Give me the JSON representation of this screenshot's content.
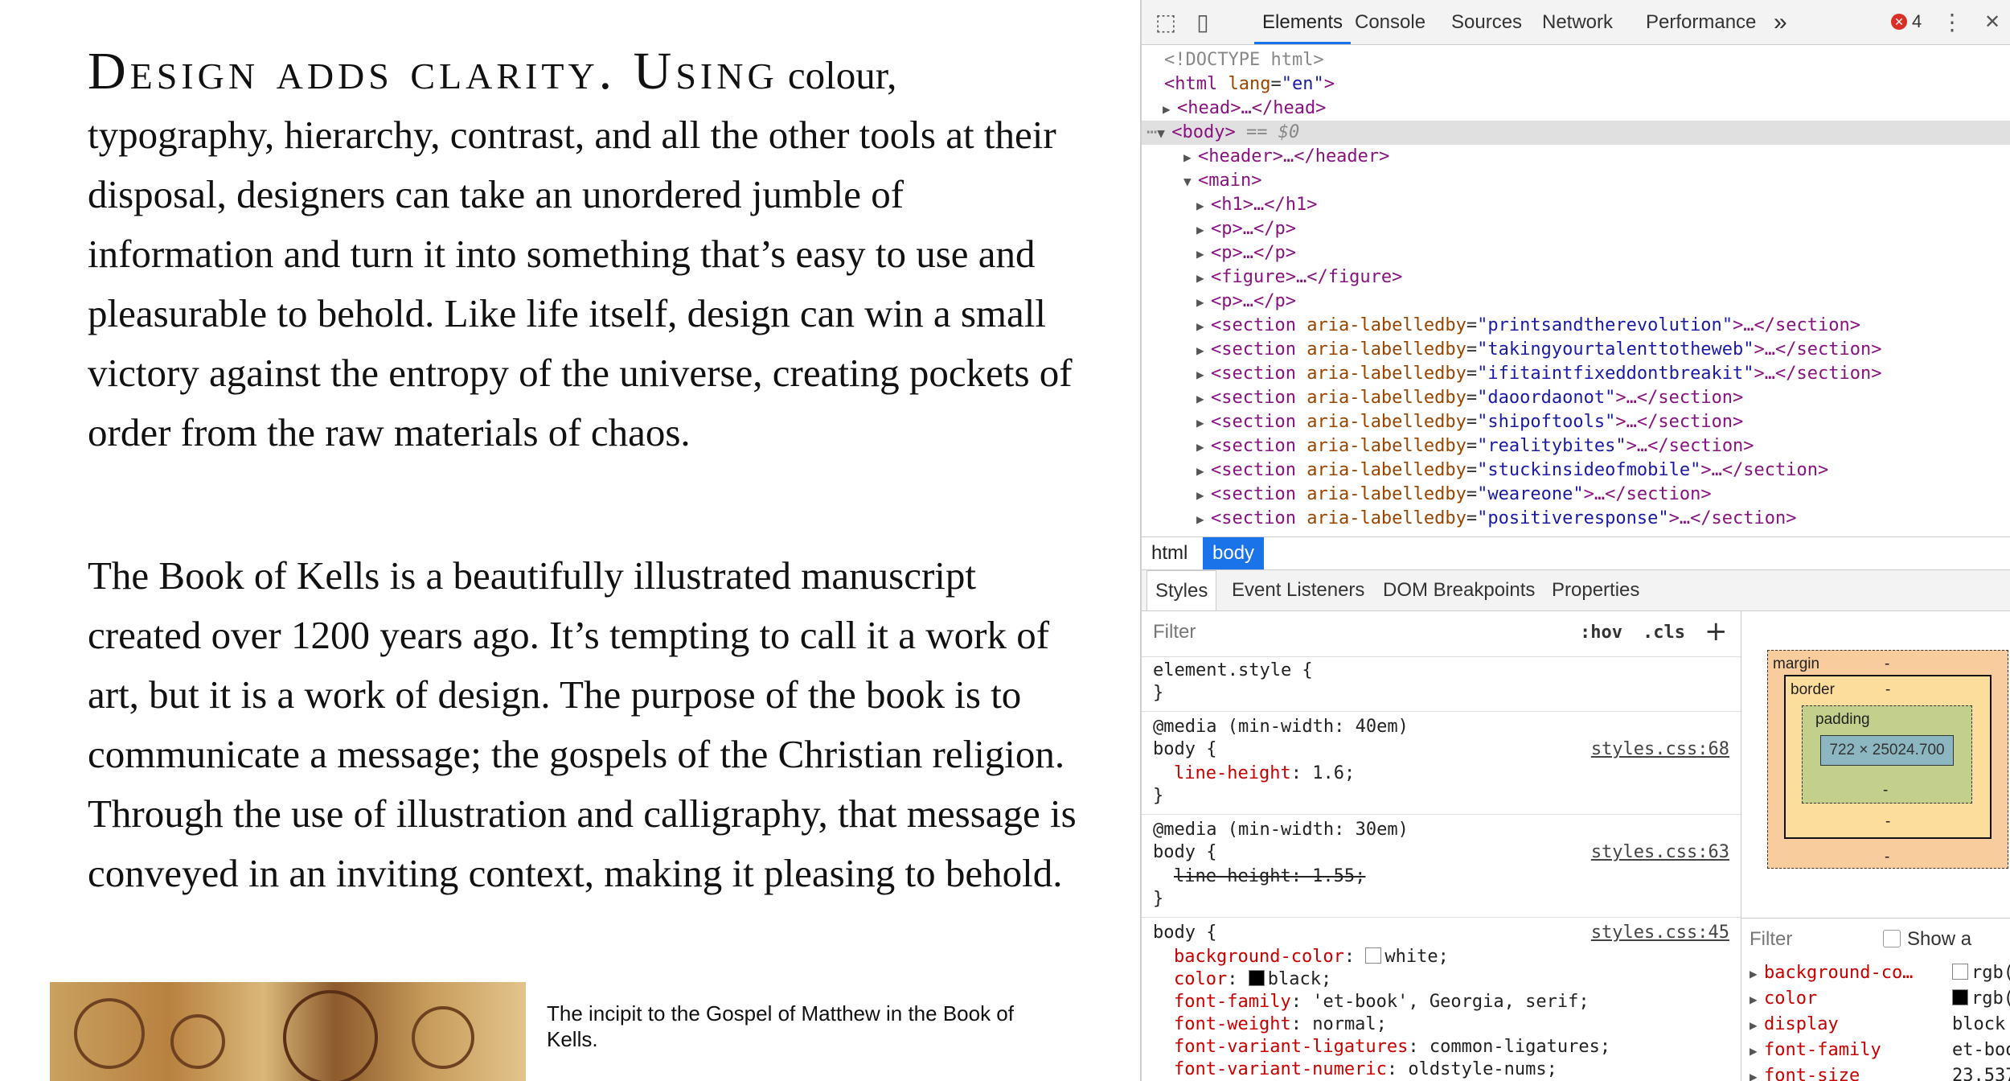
{
  "page": {
    "p1_lead": "Design adds clarity. Using",
    "p1_body": "colour, typography, hierarchy, contrast, and all the other tools at their disposal, designers can take an unordered jumble of information and turn it into something that’s easy to use and pleasurable to behold. Like life itself, design can win a small victory against the entropy of the universe, creating pockets of order from the raw materials of chaos.",
    "p2": "The Book of Kells is a beautifully illustrated manuscript created over 1200 years ago. It’s tempting to call it a work of art, but it is a work of design. The purpose of the book is to communicate a message; the gospels of the Christian religion. Through the use of illustration and calligraphy, that message is conveyed in an inviting context, making it pleasing to behold.",
    "figcaption": "The incipit to the Gospel of Matthew in the Book of Kells."
  },
  "devtools": {
    "tabs": [
      "Elements",
      "Console",
      "Sources",
      "Network",
      "Performance"
    ],
    "more": "»",
    "error_count": "4",
    "menu": "⋮",
    "close": "✕",
    "dom": {
      "doctype": "<!DOCTYPE html>",
      "html_open": "<html",
      "html_lang_attr": "lang",
      "html_lang_val": "\"en\"",
      "head": "<head>…</head>",
      "body": "<body>",
      "body_ref": "== $0",
      "header": "<header>…</header>",
      "main": "<main>",
      "children": [
        "<h1>…</h1>",
        "<p>…</p>",
        "<p>…</p>",
        "<figure>…</figure>",
        "<p>…</p>"
      ],
      "sections": [
        "printsandtherevolution",
        "takingyourtalenttotheweb",
        "ifitaintfixeddontbreakit",
        "daoordaonot",
        "shipoftools",
        "realitybites",
        "stuckinsideofmobile",
        "weareone",
        "positiveresponse"
      ],
      "section_tag": "<section",
      "section_attr": "aria-labelledby",
      "section_close": ">…</section>"
    },
    "breadcrumb": [
      "html",
      "body"
    ],
    "subtabs": [
      "Styles",
      "Event Listeners",
      "DOM Breakpoints",
      "Properties"
    ],
    "styles": {
      "filter_placeholder": "Filter",
      "hov": ":hov",
      "cls": ".cls",
      "plus": "+",
      "element_style": "element.style {",
      "close_brace": "}",
      "rule1": {
        "media": "@media (min-width: 40em)",
        "selector": "body {",
        "link": "styles.css:68",
        "prop": "line-height",
        "value": "1.6;"
      },
      "rule2": {
        "media": "@media (min-width: 30em)",
        "selector": "body {",
        "link": "styles.css:63",
        "text": "line-height: 1.55;"
      },
      "rule3": {
        "selector": "body {",
        "link": "styles.css:45",
        "decls": [
          {
            "prop": "background-color",
            "value": "white;",
            "swatch": "#ffffff"
          },
          {
            "prop": "color",
            "value": "black;",
            "swatch": "#000000"
          },
          {
            "prop": "font-family",
            "value": "'et-book', Georgia, serif;"
          },
          {
            "prop": "font-weight",
            "value": "normal;"
          },
          {
            "prop": "font-variant-ligatures",
            "value": "common-ligatures;"
          },
          {
            "prop": "font-variant-numeric",
            "value": "oldstyle-nums;"
          }
        ]
      }
    },
    "boxmodel": {
      "margin_label": "margin",
      "border_label": "border",
      "padding_label": "padding",
      "dash": "-",
      "content": "722 × 25024.700"
    },
    "computed": {
      "filter_placeholder": "Filter",
      "show_all": "Show a",
      "rows": [
        {
          "name": "background-co…",
          "value": "rgb(",
          "swatch": "#ffffff"
        },
        {
          "name": "color",
          "value": "rgb(",
          "swatch": "#000000"
        },
        {
          "name": "display",
          "value": "block"
        },
        {
          "name": "font-family",
          "value": "et-boo"
        },
        {
          "name": "font-size",
          "value": "23.537"
        }
      ]
    }
  }
}
